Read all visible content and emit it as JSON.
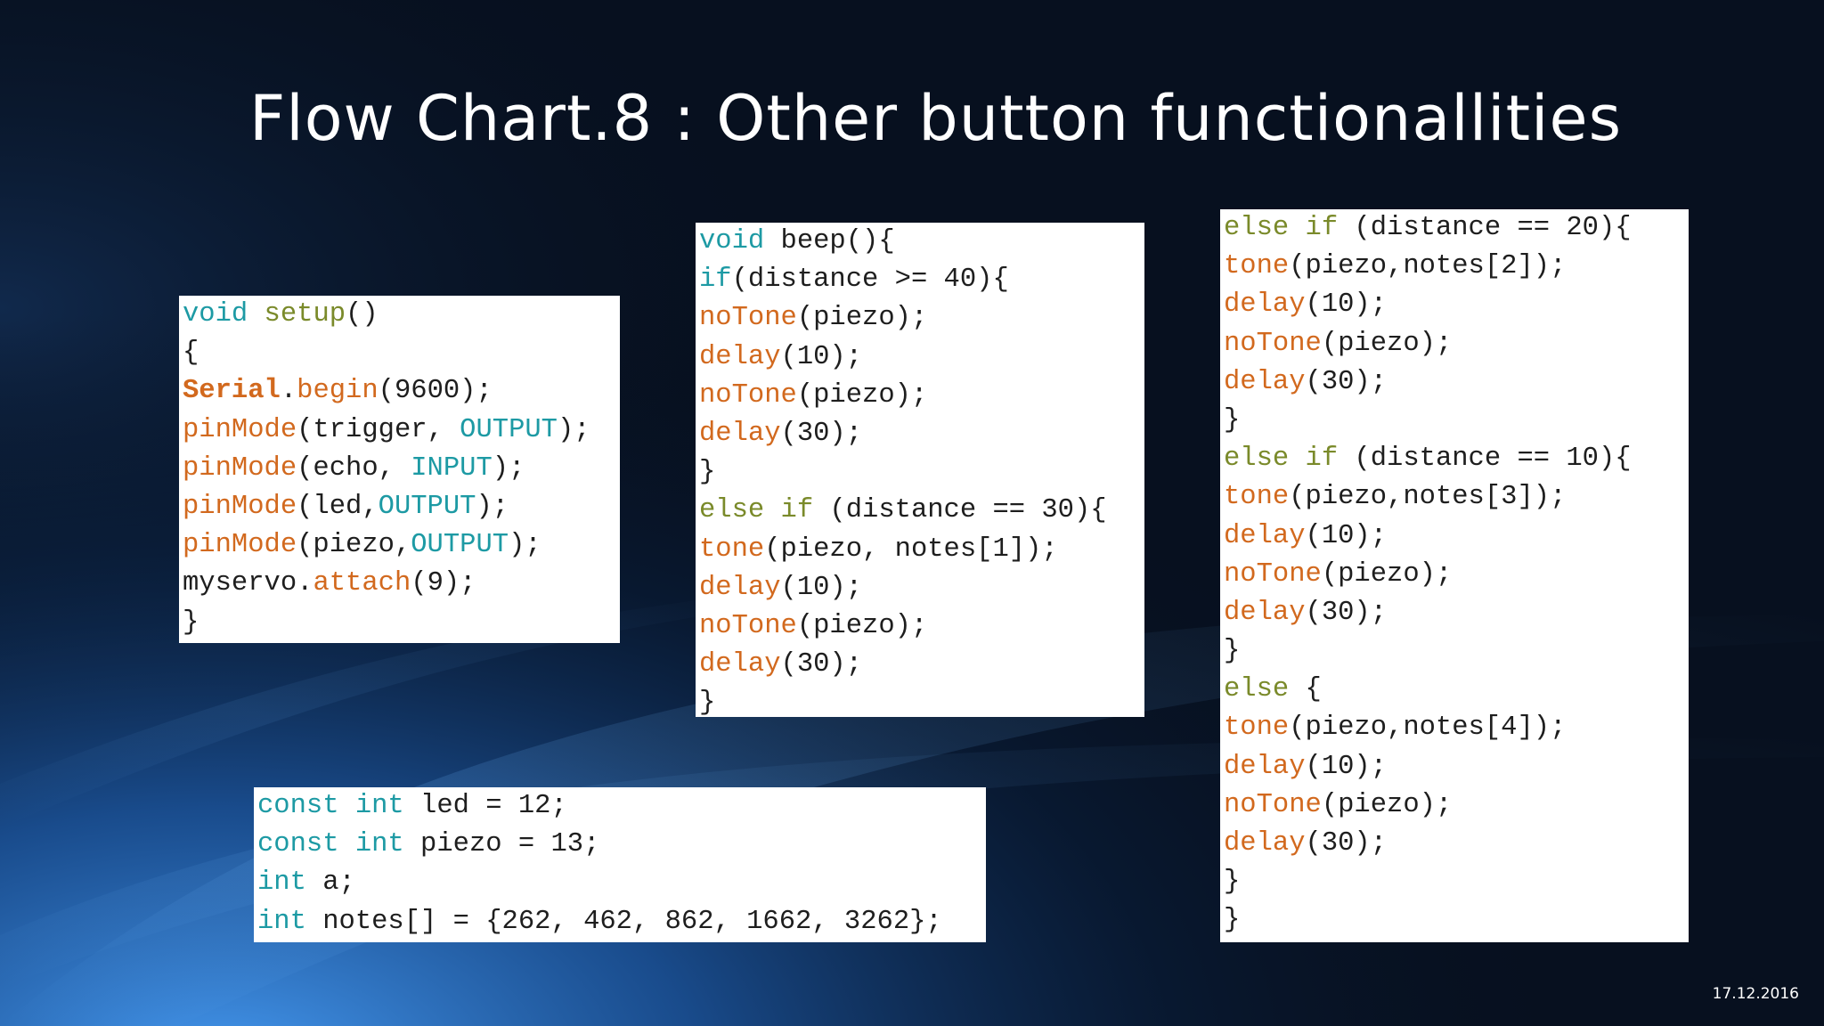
{
  "slide": {
    "title": "Flow Chart.8 : Other button functionallities",
    "date": "17.12.2016"
  },
  "colors": {
    "background": "#07101f",
    "keyword": "#1d9aa4",
    "function": "#d2691e",
    "plain": "#1e1e1e",
    "olive": "#7a8a2a"
  },
  "code_panels": {
    "setup": [
      [
        {
          "t": "void",
          "c": "kw"
        },
        {
          "t": " ",
          "c": "pl"
        },
        {
          "t": "setup",
          "c": "ol"
        },
        {
          "t": "()",
          "c": "pl"
        }
      ],
      [
        {
          "t": "{",
          "c": "pl"
        }
      ],
      [
        {
          "t": "Serial",
          "c": "fnb"
        },
        {
          "t": ".",
          "c": "pl"
        },
        {
          "t": "begin",
          "c": "fn"
        },
        {
          "t": "(9600);",
          "c": "pl"
        }
      ],
      [
        {
          "t": "pinMode",
          "c": "fn"
        },
        {
          "t": "(trigger, ",
          "c": "pl"
        },
        {
          "t": "OUTPUT",
          "c": "kw"
        },
        {
          "t": ");",
          "c": "pl"
        }
      ],
      [
        {
          "t": "pinMode",
          "c": "fn"
        },
        {
          "t": "(echo, ",
          "c": "pl"
        },
        {
          "t": "INPUT",
          "c": "kw"
        },
        {
          "t": ");",
          "c": "pl"
        }
      ],
      [
        {
          "t": "pinMode",
          "c": "fn"
        },
        {
          "t": "(led,",
          "c": "pl"
        },
        {
          "t": "OUTPUT",
          "c": "kw"
        },
        {
          "t": ");",
          "c": "pl"
        }
      ],
      [
        {
          "t": "pinMode",
          "c": "fn"
        },
        {
          "t": "(piezo,",
          "c": "pl"
        },
        {
          "t": "OUTPUT",
          "c": "kw"
        },
        {
          "t": ");",
          "c": "pl"
        }
      ],
      [
        {
          "t": "myservo.",
          "c": "pl"
        },
        {
          "t": "attach",
          "c": "fn"
        },
        {
          "t": "(9);",
          "c": "pl"
        }
      ],
      [
        {
          "t": "}",
          "c": "pl"
        }
      ]
    ],
    "beep": [
      [
        {
          "t": "void",
          "c": "kw"
        },
        {
          "t": " beep(){",
          "c": "pl"
        }
      ],
      [
        {
          "t": "if",
          "c": "kw"
        },
        {
          "t": "(distance >= 40){",
          "c": "pl"
        }
      ],
      [
        {
          "t": "noTone",
          "c": "fn"
        },
        {
          "t": "(piezo);",
          "c": "pl"
        }
      ],
      [
        {
          "t": "delay",
          "c": "fn"
        },
        {
          "t": "(10);",
          "c": "pl"
        }
      ],
      [
        {
          "t": "noTone",
          "c": "fn"
        },
        {
          "t": "(piezo);",
          "c": "pl"
        }
      ],
      [
        {
          "t": "delay",
          "c": "fn"
        },
        {
          "t": "(30);",
          "c": "pl"
        }
      ],
      [
        {
          "t": "}",
          "c": "pl"
        }
      ],
      [
        {
          "t": "else if",
          "c": "ol"
        },
        {
          "t": " (distance == 30){",
          "c": "pl"
        }
      ],
      [
        {
          "t": "tone",
          "c": "fn"
        },
        {
          "t": "(piezo, notes[1]);",
          "c": "pl"
        }
      ],
      [
        {
          "t": "delay",
          "c": "fn"
        },
        {
          "t": "(10);",
          "c": "pl"
        }
      ],
      [
        {
          "t": "noTone",
          "c": "fn"
        },
        {
          "t": "(piezo);",
          "c": "pl"
        }
      ],
      [
        {
          "t": "delay",
          "c": "fn"
        },
        {
          "t": "(30);",
          "c": "pl"
        }
      ],
      [
        {
          "t": "}",
          "c": "pl"
        }
      ]
    ],
    "elseif": [
      [
        {
          "t": "else if",
          "c": "ol"
        },
        {
          "t": " (distance == 20){",
          "c": "pl"
        }
      ],
      [
        {
          "t": "tone",
          "c": "fn"
        },
        {
          "t": "(piezo,notes[2]);",
          "c": "pl"
        }
      ],
      [
        {
          "t": "delay",
          "c": "fn"
        },
        {
          "t": "(10);",
          "c": "pl"
        }
      ],
      [
        {
          "t": "noTone",
          "c": "fn"
        },
        {
          "t": "(piezo);",
          "c": "pl"
        }
      ],
      [
        {
          "t": "delay",
          "c": "fn"
        },
        {
          "t": "(30);",
          "c": "pl"
        }
      ],
      [
        {
          "t": "}",
          "c": "pl"
        }
      ],
      [
        {
          "t": "else if",
          "c": "ol"
        },
        {
          "t": " (distance == 10){",
          "c": "pl"
        }
      ],
      [
        {
          "t": "tone",
          "c": "fn"
        },
        {
          "t": "(piezo,notes[3]);",
          "c": "pl"
        }
      ],
      [
        {
          "t": "delay",
          "c": "fn"
        },
        {
          "t": "(10);",
          "c": "pl"
        }
      ],
      [
        {
          "t": "noTone",
          "c": "fn"
        },
        {
          "t": "(piezo);",
          "c": "pl"
        }
      ],
      [
        {
          "t": "delay",
          "c": "fn"
        },
        {
          "t": "(30);",
          "c": "pl"
        }
      ],
      [
        {
          "t": "}",
          "c": "pl"
        }
      ],
      [
        {
          "t": "else",
          "c": "ol"
        },
        {
          "t": " {",
          "c": "pl"
        }
      ],
      [
        {
          "t": "tone",
          "c": "fn"
        },
        {
          "t": "(piezo,notes[4]);",
          "c": "pl"
        }
      ],
      [
        {
          "t": "delay",
          "c": "fn"
        },
        {
          "t": "(10);",
          "c": "pl"
        }
      ],
      [
        {
          "t": "noTone",
          "c": "fn"
        },
        {
          "t": "(piezo);",
          "c": "pl"
        }
      ],
      [
        {
          "t": "delay",
          "c": "fn"
        },
        {
          "t": "(30);",
          "c": "pl"
        }
      ],
      [
        {
          "t": "}",
          "c": "pl"
        }
      ],
      [
        {
          "t": "}",
          "c": "pl"
        }
      ]
    ],
    "consts": [
      [
        {
          "t": "const",
          "c": "kw"
        },
        {
          "t": " ",
          "c": "pl"
        },
        {
          "t": "int",
          "c": "kw"
        },
        {
          "t": " led = 12;",
          "c": "pl"
        }
      ],
      [
        {
          "t": "const",
          "c": "kw"
        },
        {
          "t": " ",
          "c": "pl"
        },
        {
          "t": "int",
          "c": "kw"
        },
        {
          "t": " piezo = 13;",
          "c": "pl"
        }
      ],
      [
        {
          "t": "int",
          "c": "kw"
        },
        {
          "t": " a;",
          "c": "pl"
        }
      ],
      [
        {
          "t": "int",
          "c": "kw"
        },
        {
          "t": " notes[] = {262, 462, 862, 1662, 3262};",
          "c": "pl"
        }
      ]
    ]
  }
}
